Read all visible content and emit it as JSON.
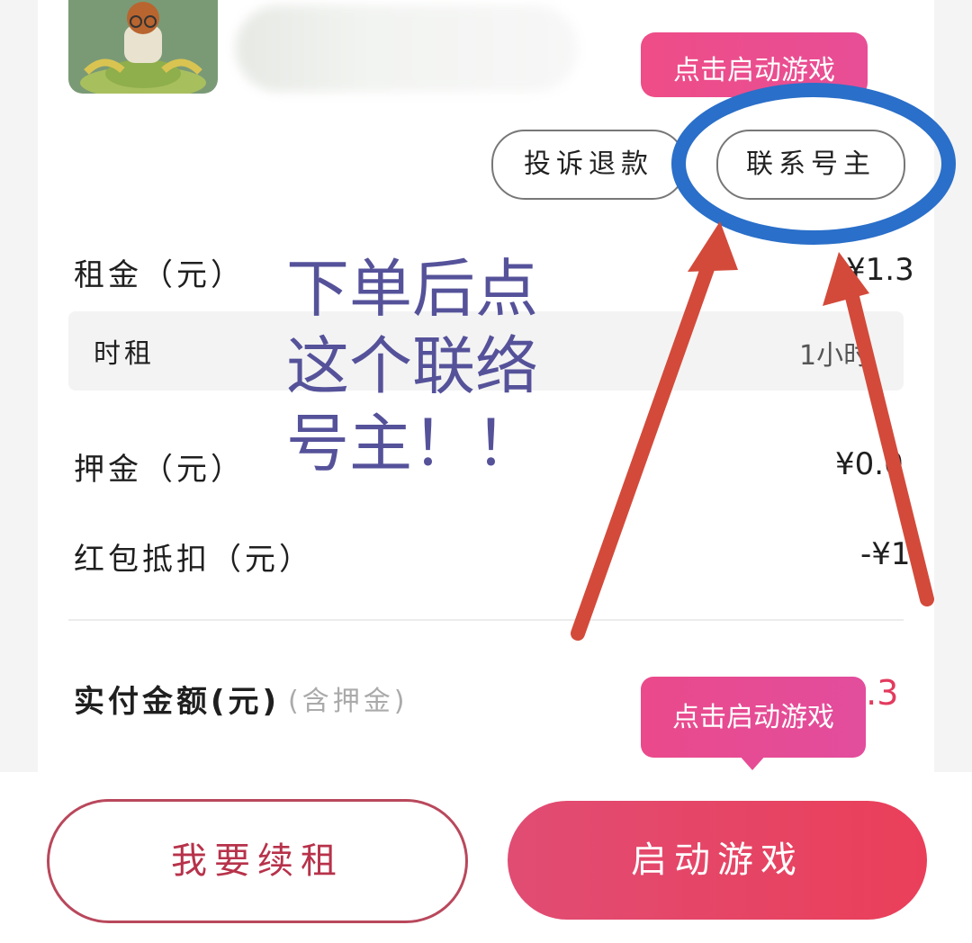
{
  "header": {
    "launch_tip": "点击启动游戏"
  },
  "actions": {
    "complaint_label": "投诉退款",
    "contact_label": "联系号主"
  },
  "details": {
    "rent_label": "租金（元）",
    "rent_value": "¥1.3",
    "rent_type_label": "时租",
    "rent_type_value": "1小时",
    "deposit_label": "押金（元）",
    "deposit_value": "¥0.0",
    "coupon_label": "红包抵扣（元）",
    "coupon_value": "-¥1",
    "paid_label": "实付金额(元)",
    "paid_note": "(含押金)",
    "paid_value": "0.3"
  },
  "annotation": {
    "lines": [
      "下单后点",
      "这个联络",
      "号主！！"
    ]
  },
  "bottom_tip": "点击启动游戏",
  "buttons": {
    "renew_label": "我要续租",
    "launch_label": "启动游戏"
  },
  "colors": {
    "accent": "#e9447f",
    "annotation_text": "#55529a",
    "circle": "#2a6fc9",
    "arrow": "#d34a3a"
  }
}
